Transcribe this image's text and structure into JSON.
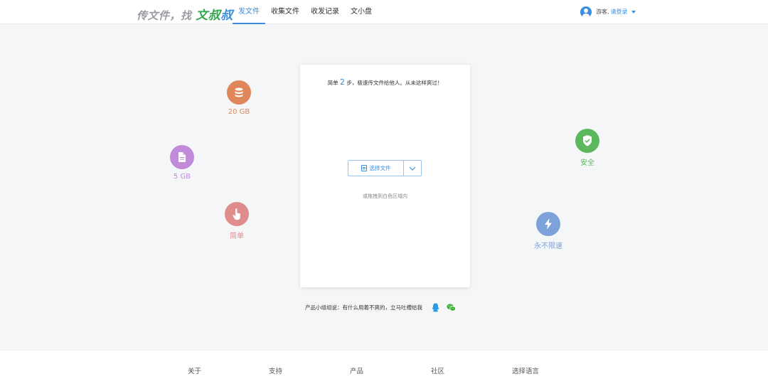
{
  "header": {
    "logo_prefix": "传文件，找",
    "logo_brand_a": "文叔",
    "logo_brand_b": "叔",
    "nav": [
      {
        "label": "发文件",
        "active": true
      },
      {
        "label": "收集文件",
        "active": false
      },
      {
        "label": "收发记录",
        "active": false
      },
      {
        "label": "文小盘",
        "active": false
      }
    ],
    "user": {
      "guest": "游客,",
      "login": "请登录"
    }
  },
  "card": {
    "tagline_pre": "简单",
    "tagline_num": "2",
    "tagline_post": "步，极速传文件给他人。从未这样爽过！",
    "select_label": "选择文件",
    "drop_hint": "或拖拽到白色区域内"
  },
  "features": [
    {
      "name": "storage",
      "label": "20 GB",
      "color": "#df875a",
      "icon": "database-icon"
    },
    {
      "name": "file-size",
      "label": "5 GB",
      "color": "#c18bd9",
      "icon": "document-icon"
    },
    {
      "name": "simple",
      "label": "简单",
      "color": "#df8c8c",
      "icon": "hand-pointer-icon"
    },
    {
      "name": "secure",
      "label": "安全",
      "color": "#5cb85c",
      "icon": "shield-check-icon"
    },
    {
      "name": "speed",
      "label": "永不限速",
      "color": "#7da2d9",
      "icon": "lightning-icon"
    }
  ],
  "feedback": {
    "text": "产品小组组说：有什么用着不爽的，立马吐槽给我",
    "qq_color": "#2a9ae6",
    "wechat_color": "#3cb034"
  },
  "footer": {
    "links": [
      "关于",
      "支持",
      "产品",
      "社区",
      "选择语言"
    ]
  }
}
